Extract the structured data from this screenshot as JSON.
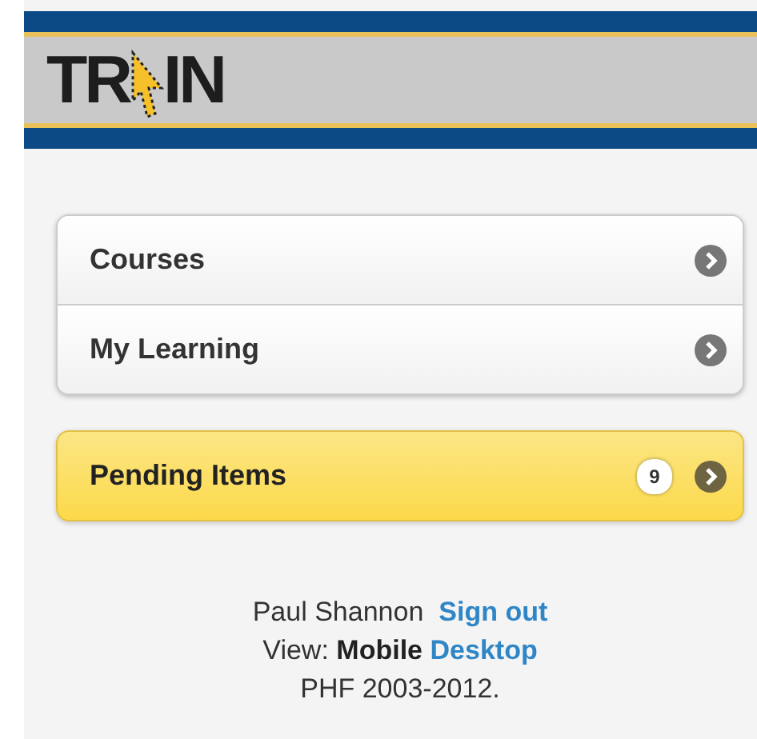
{
  "header": {
    "logo_start": "TR",
    "logo_end": "IN"
  },
  "menu": [
    {
      "label": "Courses"
    },
    {
      "label": "My Learning"
    }
  ],
  "pending": {
    "label": "Pending Items",
    "count": "9"
  },
  "footer": {
    "user": "Paul Shannon",
    "sign_out": "Sign out",
    "view_label": "View:",
    "views": [
      {
        "label": "Mobile",
        "selected": true
      },
      {
        "label": "Desktop",
        "selected": false
      }
    ],
    "copyright": "PHF 2003-2012."
  }
}
